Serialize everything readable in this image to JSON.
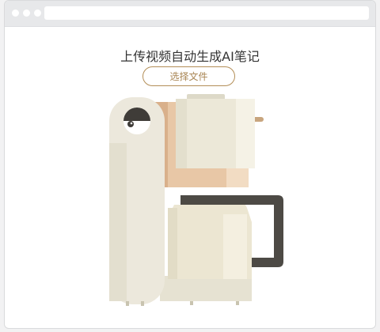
{
  "page": {
    "title": "上传视频自动生成AI笔记",
    "upload_button_label": "选择文件"
  },
  "browser": {
    "window_dots": [
      "close",
      "minimize",
      "maximize"
    ],
    "address_bar_value": ""
  },
  "illustration": {
    "subject": "coffee-machine",
    "colors": {
      "machine_body": "#ece8dc",
      "wood_panel": "#e8c7a6",
      "pot_handle": "#4d4a45",
      "accent_button": "#b38e57"
    }
  }
}
